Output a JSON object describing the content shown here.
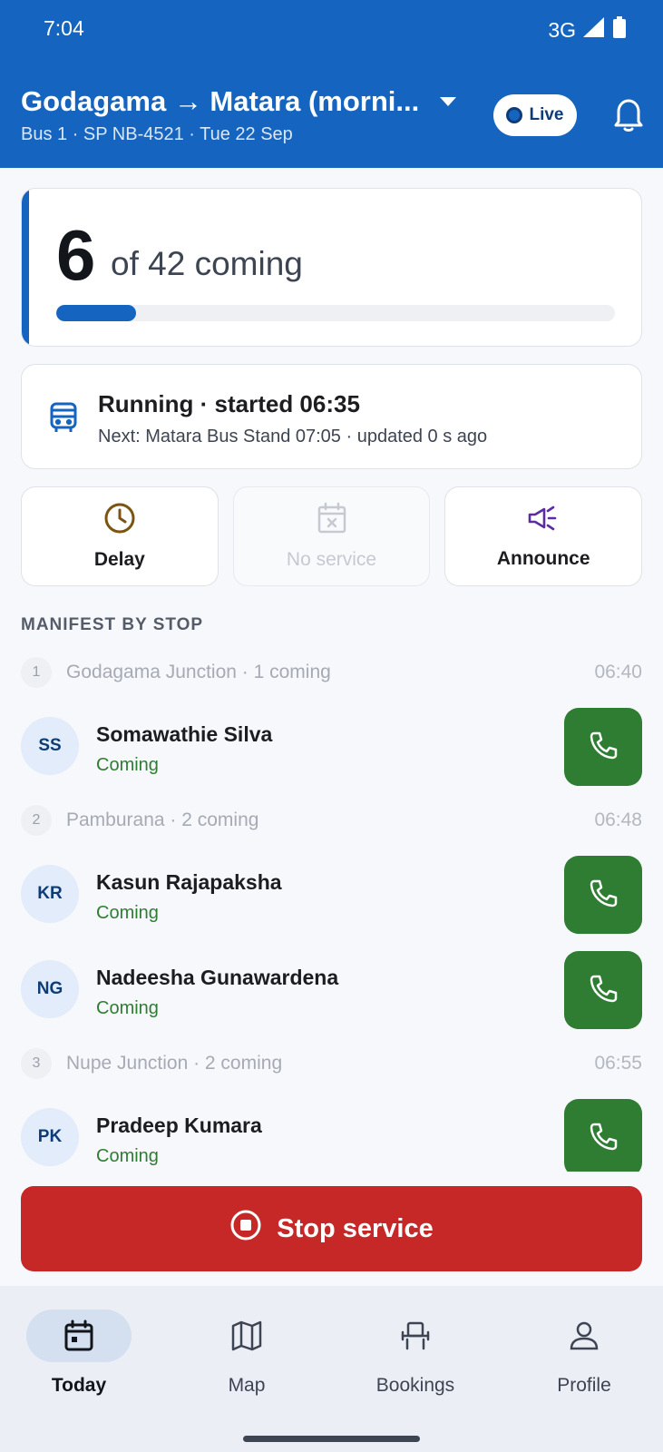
{
  "status_bar": {
    "time": "7:04",
    "network": "3G"
  },
  "header": {
    "route_title": "Godagama → Matara (morni...",
    "route_subtitle": "Bus 1 · SP NB-4521 · Tue 22 Sep",
    "live_label": "Live"
  },
  "summary": {
    "count": "6",
    "of_text": "of 42 coming",
    "progress_fraction": 0.143
  },
  "running": {
    "title": "Running · started 06:35",
    "subtitle": "Next: Matara Bus Stand 07:05 · updated 0 s ago"
  },
  "actions": {
    "delay": "Delay",
    "no_service": "No service",
    "announce": "Announce"
  },
  "manifest": {
    "section_label": "MANIFEST BY STOP",
    "stops": [
      {
        "number": "1",
        "label": "Godagama Junction · 1 coming",
        "time": "06:40"
      },
      {
        "number": "2",
        "label": "Pamburana · 2 coming",
        "time": "06:48"
      },
      {
        "number": "3",
        "label": "Nupe Junction · 2 coming",
        "time": "06:55"
      }
    ],
    "passengers": [
      {
        "initials": "SS",
        "name": "Somawathie Silva",
        "status": "Coming"
      },
      {
        "initials": "KR",
        "name": "Kasun Rajapaksha",
        "status": "Coming"
      },
      {
        "initials": "NG",
        "name": "Nadeesha Gunawardena",
        "status": "Coming"
      },
      {
        "initials": "PK",
        "name": "Pradeep Kumara",
        "status": "Coming"
      }
    ]
  },
  "stop_service_label": "Stop service",
  "nav": {
    "today": "Today",
    "map": "Map",
    "bookings": "Bookings",
    "profile": "Profile"
  },
  "colors": {
    "brand": "#1565c0",
    "success": "#2e7d32",
    "danger": "#c62828"
  }
}
